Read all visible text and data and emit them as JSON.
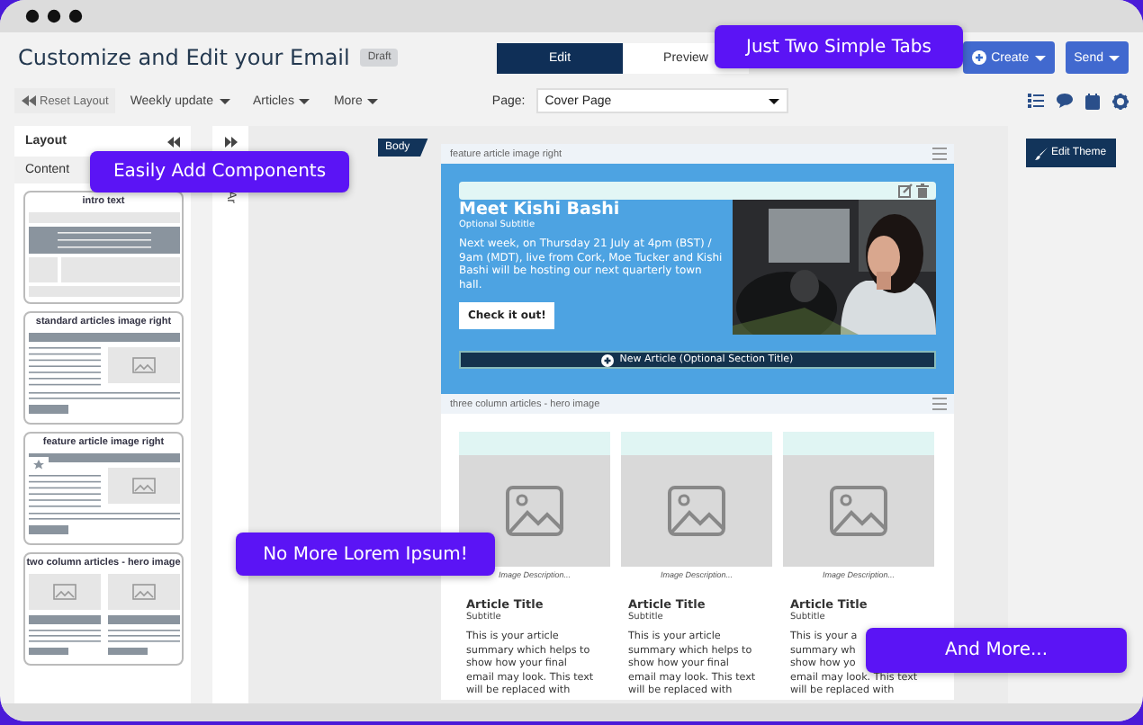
{
  "header": {
    "title": "Customize and Edit your Email",
    "badge": "Draft",
    "tabs": [
      {
        "label": "Edit",
        "selected": true
      },
      {
        "label": "Preview",
        "selected": false
      }
    ],
    "buttons": [
      {
        "label": "Create",
        "kind": "create"
      },
      {
        "label": "Send",
        "kind": "send"
      }
    ]
  },
  "toolbar": {
    "reset": "Reset Layout",
    "menus": [
      "Weekly update",
      "Articles",
      "More"
    ],
    "page_label": "Page:",
    "page_value": "Cover Page"
  },
  "layout_panel": {
    "title": "Layout",
    "tab": "Content",
    "components": [
      {
        "title": "intro text",
        "kind": "intro"
      },
      {
        "title": "standard articles image right",
        "kind": "image_right"
      },
      {
        "title": "feature article image right",
        "kind": "feature"
      },
      {
        "title": "two column articles - hero image",
        "kind": "two_column"
      }
    ]
  },
  "collapsed_panel": {
    "label": "Ar"
  },
  "canvas": {
    "body_tag": "Body",
    "edit_theme": "Edit Theme",
    "feature": {
      "heading": "feature article image right",
      "title": "Meet Kishi Bashi",
      "subtitle": "Optional Subtitle",
      "text": "Next week, on Thursday 21 July at 4pm (BST) / 9am (MDT), live from Cork, Moe Tucker and Kishi Bashi will be hosting our next quarterly town hall.",
      "button": "Check it out!",
      "new_article": "New Article (Optional Section Title)"
    },
    "columns_section": {
      "heading": "three column articles - hero image",
      "columns": [
        {
          "caption": "Image Description...",
          "title": "Article Title",
          "subtitle": "Subtitle",
          "text": "This is your article\nsummary which helps to\nshow how your final\nemail may look. This text\nwill be replaced with"
        },
        {
          "caption": "Image Description...",
          "title": "Article Title",
          "subtitle": "Subtitle",
          "text": "This is your article\nsummary which helps to\nshow how your final\nemail may look. This text\nwill be replaced with"
        },
        {
          "caption": "Image Description...",
          "title": "Article Title",
          "subtitle": "Subtitle",
          "text": "This is your a\nsummary wh\nshow how yo\nemail may look. This text\nwill be replaced with"
        }
      ]
    }
  },
  "callouts": [
    {
      "text": "Just Two Simple Tabs",
      "kind": "tabs"
    },
    {
      "text": "Easily Add Components",
      "kind": "components"
    },
    {
      "text": "No More Lorem Ipsum!",
      "kind": "lorem"
    },
    {
      "text": "And More...",
      "kind": "more"
    }
  ]
}
